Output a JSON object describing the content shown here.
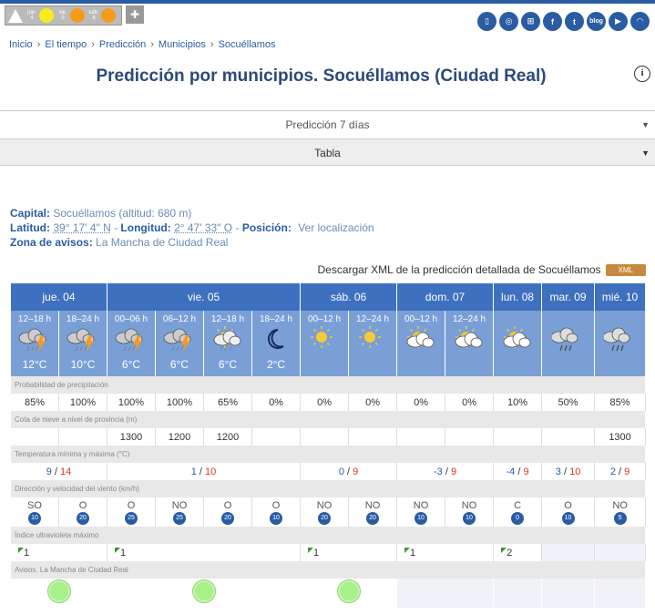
{
  "alerts": {
    "days": [
      {
        "label": "jue. 4",
        "color": "#f7ec1c"
      },
      {
        "label": "vie. 5",
        "color": "#f79a1c"
      },
      {
        "label": "sáb. 6",
        "color": "#f79a1c"
      }
    ]
  },
  "social": [
    "cell",
    "globe",
    "net",
    "f",
    "t",
    "blog",
    "yt",
    "rss"
  ],
  "breadcrumb": [
    "Inicio",
    "El tiempo",
    "Predicción",
    "Municipios",
    "Socuéllamos"
  ],
  "page_title": "Predicción por municipios. Socuéllamos (Ciudad Real)",
  "tabs": {
    "seven_days": "Predicción 7 días",
    "table": "Tabla"
  },
  "meta": {
    "capital_label": "Capital:",
    "capital_value": "Socuéllamos (altitud: 680 m)",
    "lat_label": "Latitud:",
    "lat_value": "39° 17' 4\" N",
    "lon_label": "Longitud:",
    "lon_value": "2° 47' 33\" O",
    "pos_label": "Posición:",
    "pos_value": "Ver localización",
    "zone_label": "Zona de avisos:",
    "zone_value": "La Mancha de Ciudad Real"
  },
  "download": {
    "text": "Descargar XML de la predicción detallada de Socuéllamos",
    "badge": "XML"
  },
  "days": [
    {
      "label": "jue. 04",
      "span": 2
    },
    {
      "label": "vie. 05",
      "span": 4
    },
    {
      "label": "sáb. 06",
      "span": 2
    },
    {
      "label": "dom. 07",
      "span": 2
    },
    {
      "label": "lun. 08",
      "span": 1
    },
    {
      "label": "mar. 09",
      "span": 1
    },
    {
      "label": "mié. 10",
      "span": 1
    }
  ],
  "periods": [
    "12–18 h",
    "18–24 h",
    "00–06 h",
    "06–12 h",
    "12–18 h",
    "18–24 h",
    "00–12 h",
    "12–24 h",
    "00–12 h",
    "12–24 h",
    "",
    "",
    ""
  ],
  "icons": [
    "storm",
    "storm",
    "storm",
    "storm",
    "sun-cloud-rain",
    "moon",
    "sun",
    "sun",
    "sun-cloud",
    "sun-cloud",
    "sun-cloud",
    "rain",
    "rain"
  ],
  "temps": [
    "12°C",
    "10°C",
    "6°C",
    "6°C",
    "6°C",
    "2°C",
    "",
    "",
    "",
    "",
    "",
    "",
    ""
  ],
  "sections": {
    "precip": "Probabilidad de precipitación",
    "snow": "Cota de nieve a nivel de provincia (m)",
    "temp": "Temperatura mínima y máxima (°C)",
    "wind": "Dirección y velocidad del viento (km/h)",
    "uv": "Índice ultravioleta máximo",
    "avisos": "Avisos. La Mancha de Ciudad Real"
  },
  "precip": [
    "85%",
    "100%",
    "100%",
    "100%",
    "65%",
    "0%",
    "0%",
    "0%",
    "0%",
    "0%",
    "10%",
    "50%",
    "85%"
  ],
  "snow": [
    "",
    "",
    "1300",
    "1200",
    "1200",
    "",
    "",
    "",
    "",
    "",
    "",
    "",
    "1300"
  ],
  "minmax": [
    {
      "min": "9",
      "max": "14",
      "span": 2
    },
    {
      "min": "1",
      "max": "10",
      "span": 4
    },
    {
      "min": "0",
      "max": "9",
      "span": 2
    },
    {
      "min": "-3",
      "max": "9",
      "span": 2
    },
    {
      "min": "-4",
      "max": "9",
      "span": 1
    },
    {
      "min": "3",
      "max": "10",
      "span": 1
    },
    {
      "min": "2",
      "max": "9",
      "span": 1
    }
  ],
  "wind": [
    {
      "dir": "SO",
      "speed": "10"
    },
    {
      "dir": "O",
      "speed": "20"
    },
    {
      "dir": "O",
      "speed": "25"
    },
    {
      "dir": "NO",
      "speed": "25"
    },
    {
      "dir": "O",
      "speed": "20"
    },
    {
      "dir": "O",
      "speed": "10"
    },
    {
      "dir": "NO",
      "speed": "20"
    },
    {
      "dir": "NO",
      "speed": "20"
    },
    {
      "dir": "NO",
      "speed": "10"
    },
    {
      "dir": "NO",
      "speed": "10"
    },
    {
      "dir": "C",
      "speed": "0"
    },
    {
      "dir": "O",
      "speed": "10"
    },
    {
      "dir": "NO",
      "speed": "5"
    }
  ],
  "uv": [
    {
      "val": "1",
      "span": 2
    },
    {
      "val": "1",
      "span": 4
    },
    {
      "val": "1",
      "span": 2
    },
    {
      "val": "1",
      "span": 2
    },
    {
      "val": "2",
      "span": 1
    },
    {
      "val": "",
      "span": 1
    },
    {
      "val": "",
      "span": 1
    }
  ],
  "avisos": [
    {
      "level": "green",
      "span": 2
    },
    {
      "level": "green",
      "span": 4
    },
    {
      "level": "green",
      "span": 2
    },
    {
      "level": "",
      "span": 2
    },
    {
      "level": "",
      "span": 1
    },
    {
      "level": "",
      "span": 1
    },
    {
      "level": "",
      "span": 1
    }
  ]
}
